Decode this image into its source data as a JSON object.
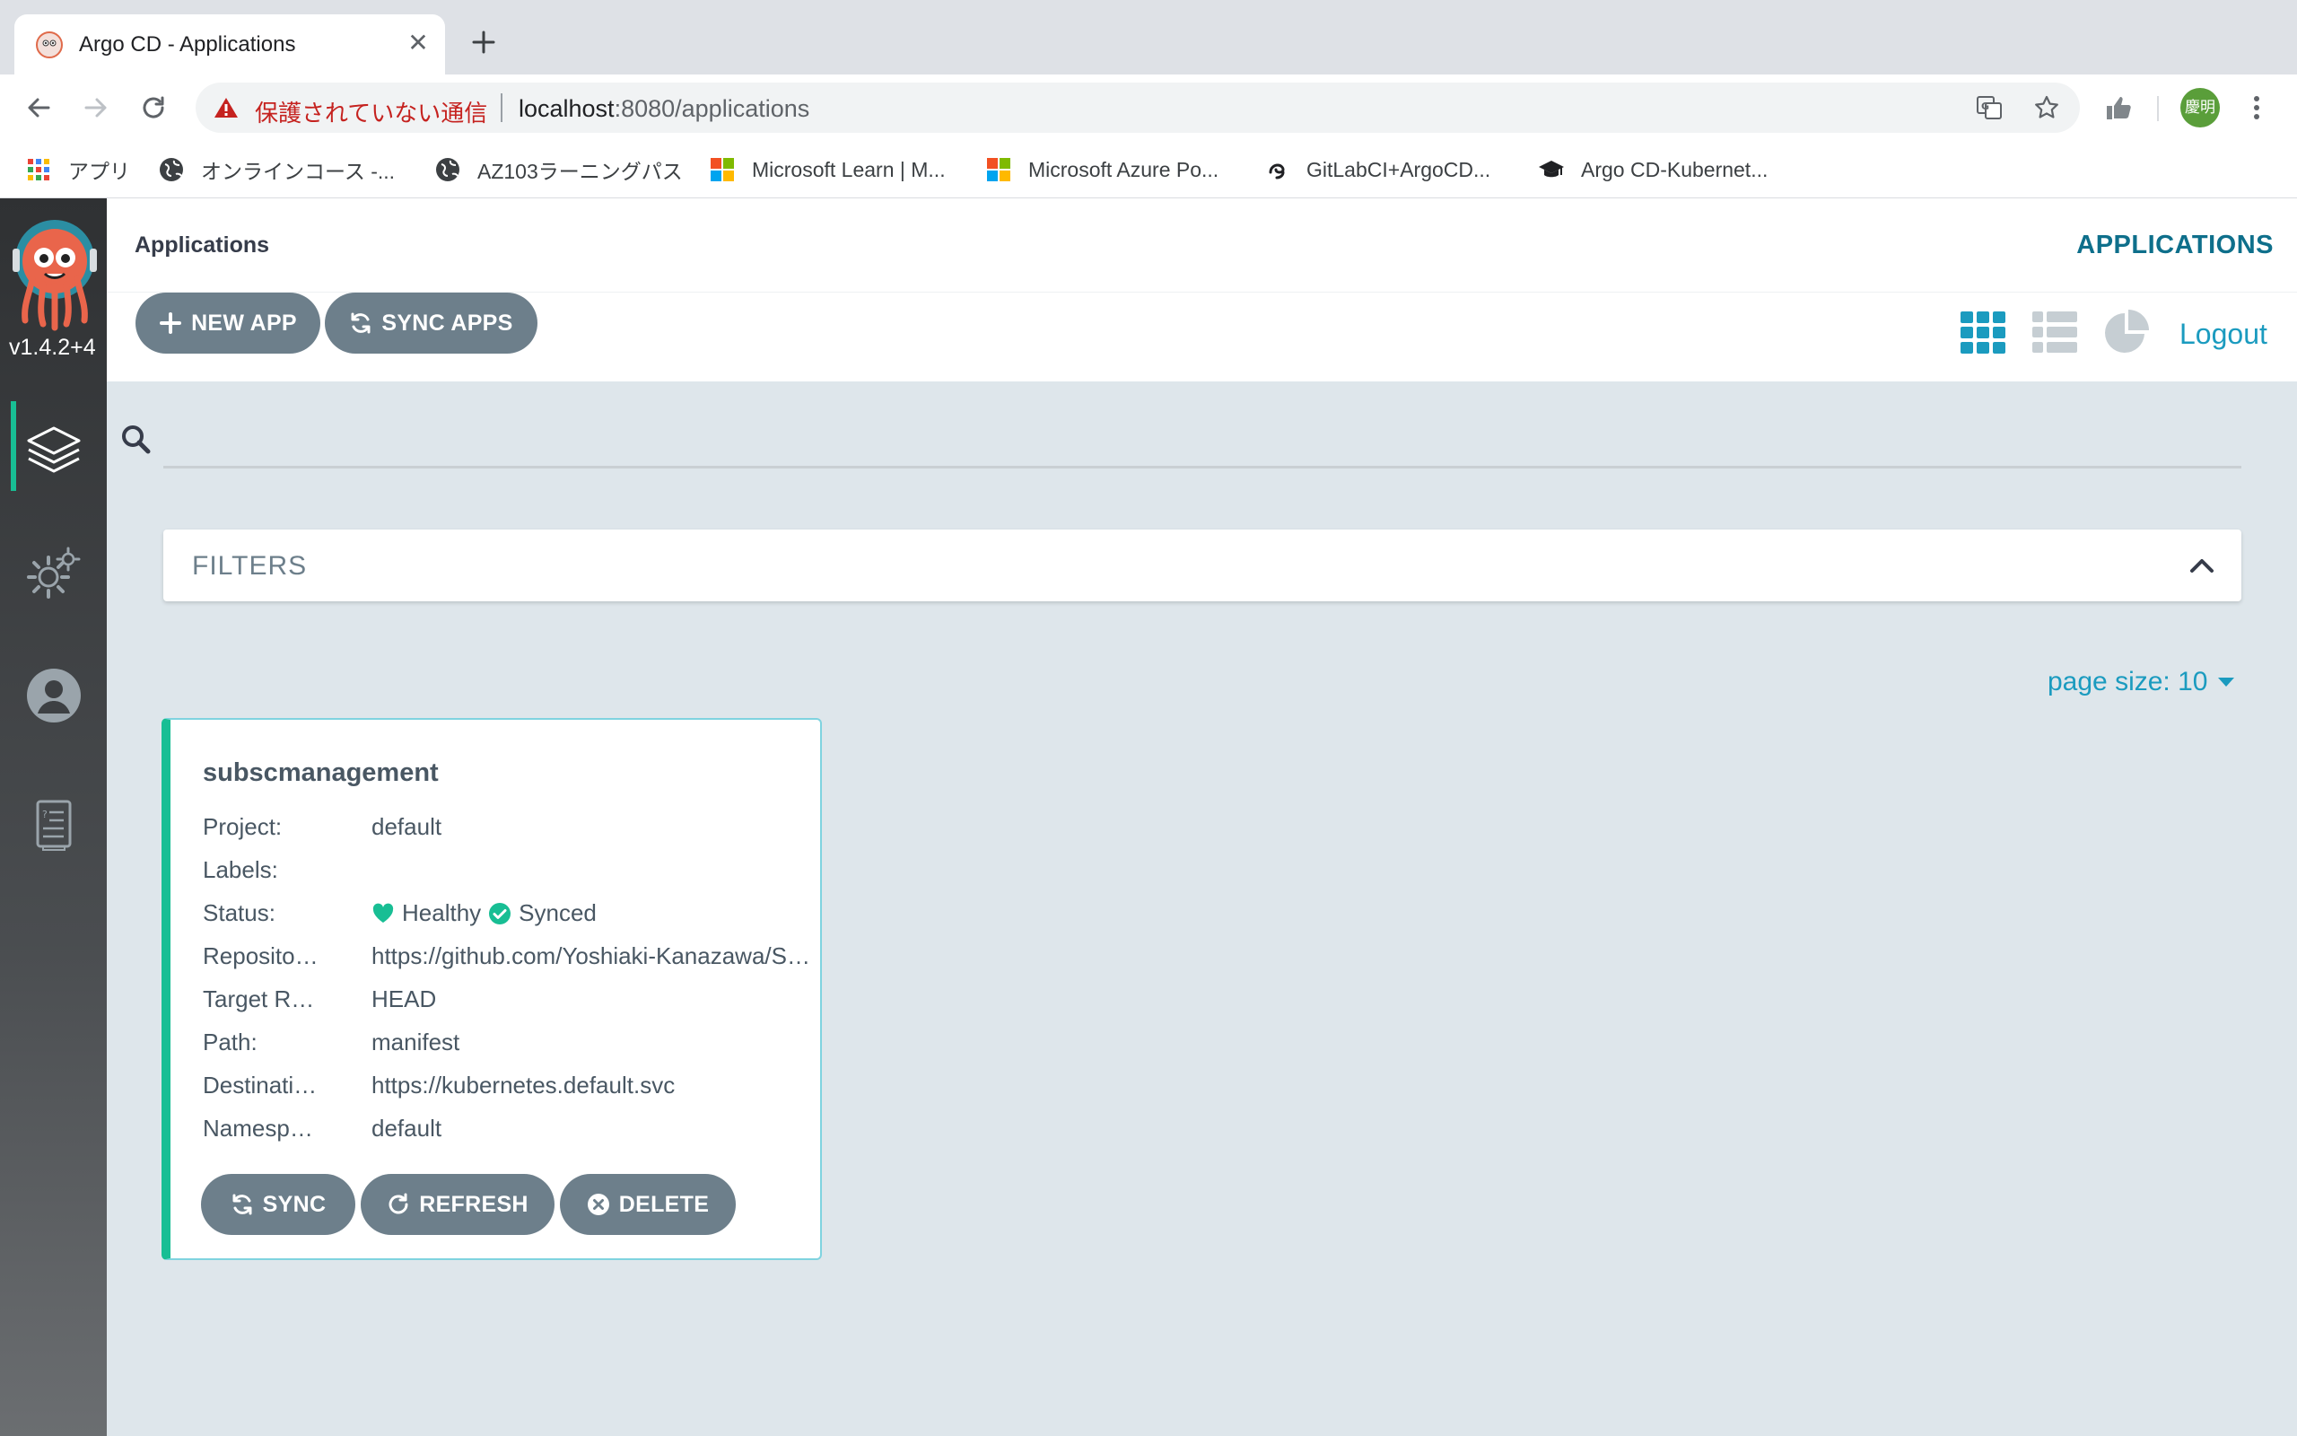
{
  "browser": {
    "tab_title": "Argo CD - Applications",
    "insecure_label": "保護されていない通信",
    "url_host": "localhost",
    "url_rest": ":8080/applications",
    "profile_initials": "慶明",
    "bookmarks": [
      {
        "label": "アプリ",
        "icon": "apps-grid-icon"
      },
      {
        "label": "オンラインコース -...",
        "icon": "globe-icon"
      },
      {
        "label": "AZ103ラーニングパス",
        "icon": "globe-icon"
      },
      {
        "label": "Microsoft Learn | M...",
        "icon": "microsoft-icon"
      },
      {
        "label": "Microsoft Azure Po...",
        "icon": "microsoft-icon"
      },
      {
        "label": "GitLabCI+ArgoCD...",
        "icon": "site-icon"
      },
      {
        "label": "Argo CD-Kubernet...",
        "icon": "graduation-cap-icon"
      }
    ]
  },
  "sidebar": {
    "version": "v1.4.2+4"
  },
  "header": {
    "title": "Applications",
    "right_title": "APPLICATIONS"
  },
  "actions": {
    "new_app": "NEW APP",
    "sync_apps": "SYNC APPS",
    "logout": "Logout"
  },
  "search": {
    "placeholder": ""
  },
  "filters": {
    "label": "FILTERS"
  },
  "pagination": {
    "page_size": "page size: 10"
  },
  "app": {
    "name": "subscmanagement",
    "rows": [
      {
        "key": "Project:",
        "value": "default"
      },
      {
        "key": "Labels:",
        "value": ""
      },
      {
        "key": "Status:",
        "value": ""
      },
      {
        "key": "Repository:",
        "value": "https://github.com/Yoshiaki-Kanazawa/SubscManagement"
      },
      {
        "key": "Target Revision:",
        "value": "HEAD"
      },
      {
        "key": "Path:",
        "value": "manifest"
      },
      {
        "key": "Destination:",
        "value": "https://kubernetes.default.svc"
      },
      {
        "key": "Namespace:",
        "value": "default"
      }
    ],
    "health": "Healthy",
    "sync": "Synced",
    "buttons": {
      "sync": "SYNC",
      "refresh": "REFRESH",
      "delete": "DELETE"
    },
    "colors": {
      "healthy": "#18be94",
      "accent": "#18be94"
    }
  }
}
